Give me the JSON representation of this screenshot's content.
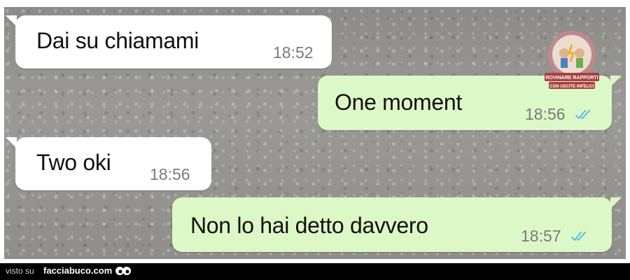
{
  "messages": [
    {
      "direction": "incoming",
      "text": "Dai su chiamami",
      "time": "18:52"
    },
    {
      "direction": "outgoing",
      "text": "One moment",
      "time": "18:56",
      "status": "read"
    },
    {
      "direction": "incoming",
      "text": "Two oki",
      "time": "18:56"
    },
    {
      "direction": "outgoing",
      "text": "Non lo hai detto davvero",
      "time": "18:57",
      "status": "read"
    }
  ],
  "watermark": {
    "line1": "Rovinare Rapporti",
    "line2": "Con Uscite Infelici"
  },
  "footer": {
    "prefix": "visto su",
    "site": "facciabuco.com"
  },
  "colors": {
    "incoming_bubble": "#ffffff",
    "outgoing_bubble": "#dcf8c6",
    "read_ticks": "#4fb6ec",
    "footer_background": "#000000"
  }
}
